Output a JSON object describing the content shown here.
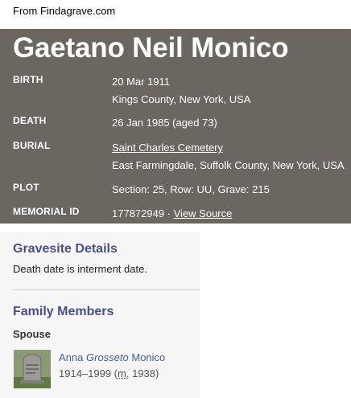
{
  "source_note": "From Findagrave.com",
  "memorial": {
    "name": "Gaetano Neil Monico",
    "birth": {
      "label": "BIRTH",
      "date": "20 Mar 1911",
      "place": "Kings County, New York, USA"
    },
    "death": {
      "label": "DEATH",
      "value": "26 Jan 1985 (aged 73)"
    },
    "burial": {
      "label": "BURIAL",
      "cemetery": "Saint Charles Cemetery",
      "place": "East Farmingdale, Suffolk County, New York, USA"
    },
    "plot": {
      "label": "PLOT",
      "value": "Section: 25, Row: UU, Grave: 215"
    },
    "memorial_id": {
      "label": "MEMORIAL ID",
      "value": "177872949 · ",
      "link": "View Source"
    }
  },
  "gravesite": {
    "title": "Gravesite Details",
    "text": "Death date is interment date."
  },
  "family": {
    "title": "Family Members",
    "spouse_label": "Spouse",
    "spouse": {
      "first": "Anna",
      "maiden": "Grosseto",
      "last": "Monico",
      "dates": "1914–1999 (",
      "married_abbr": "m.",
      "married_year": " 1938)"
    }
  }
}
